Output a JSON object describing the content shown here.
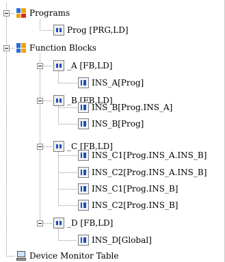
{
  "tree": {
    "programs": {
      "label": "Programs",
      "icon": "programs-folder-icon",
      "children": [
        {
          "label": "Prog [PRG,LD]",
          "icon": "program-icon"
        }
      ]
    },
    "function_blocks": {
      "label": "Function Blocks",
      "icon": "function-blocks-folder-icon",
      "fb_a": {
        "label": "_A [FB,LD]",
        "instances": [
          "INS_A[Prog]"
        ]
      },
      "fb_b": {
        "label": "_B [FB,LD]",
        "instances": [
          "INS_B[Prog.INS_A]",
          "INS_B[Prog]"
        ]
      },
      "fb_c": {
        "label": "_C [FB,LD]",
        "instances": [
          "INS_C1[Prog.INS_A.INS_B]",
          "INS_C2[Prog.INS_A.INS_B]",
          "INS_C1[Prog.INS_B]",
          "INS_C2[Prog.INS_B]"
        ]
      },
      "fb_d": {
        "label": "_D [FB,LD]",
        "instances": [
          "INS_D[Global]"
        ]
      }
    },
    "device_monitor": {
      "label": "Device Monitor Table",
      "icon": "device-monitor-icon"
    }
  }
}
